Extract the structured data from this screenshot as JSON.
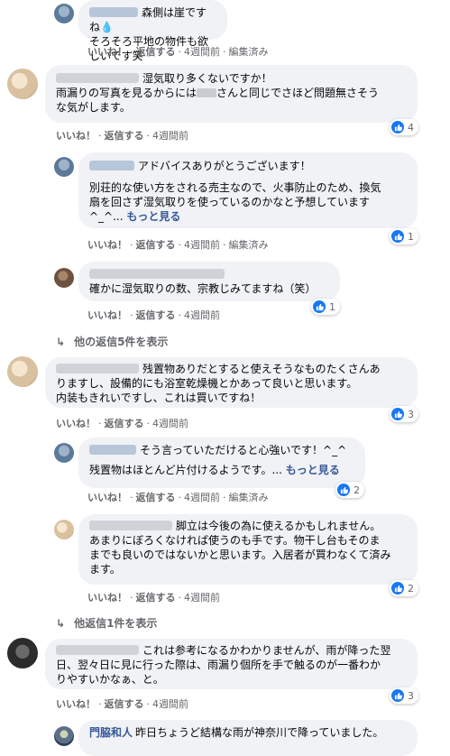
{
  "labels": {
    "like": "いいね！",
    "reply": "返信する",
    "edited": "編集済み",
    "dot": "·"
  },
  "comments": [
    {
      "text_lines": [
        "森側は崖ですね",
        "そろそろ平地の物件も欲しいです笑"
      ],
      "time": "4週間前",
      "edited": true
    },
    {
      "text_lines": [
        "湿気取り多くないですか！",
        "雨漏りの写真を見るからには",
        "さんと同じでさほど問題無さそう",
        "な気がします。"
      ],
      "time": "4週間前",
      "reactions": "4"
    },
    {
      "text_lines": [
        "アドバイスありがとうございます！",
        "別荘的な使い方をされる売主なので、火事防止のため、換気",
        "扇を回さず湿気取りを使っているのかなと予想しています",
        "^_^..."
      ],
      "see_more": "もっと見る",
      "time": "4週間前",
      "edited": true,
      "reactions": "1"
    },
    {
      "text_lines": [
        "確かに湿気取りの数、宗教じみてますね（笑）"
      ],
      "time": "4週間前",
      "reactions": "1"
    },
    {
      "more_replies": "他の返信5件を表示"
    },
    {
      "text_lines": [
        "残置物ありだとすると使えそうなものたくさんあ",
        "りますし、設備的にも浴室乾燥機とかあって良いと思います。",
        "内装もきれいですし、これは買いですね！"
      ],
      "time": "4週間前",
      "reactions": "3"
    },
    {
      "text_lines": [
        "そう言っていただけると心強いです！^_^",
        "残置物はほとんど片付けるようです。..."
      ],
      "see_more": "もっと見る",
      "time": "4週間前",
      "edited": true,
      "reactions": "2"
    },
    {
      "text_lines": [
        "脚立は今後の為に使えるかもしれません。",
        "あまりにぼろくなければ使うのも手です。物干し台もそのま",
        "までも良いのではないかと思います。入居者が買わなくて済み",
        "ます。"
      ],
      "time": "4週間前",
      "reactions": "2"
    },
    {
      "more_replies": "他返信1件を表示"
    },
    {
      "text_lines": [
        "これは参考になるかわかりませんが、雨が降った翌",
        "日、翌々日に見に行った際は、雨漏り個所を手で触るのが一番わか",
        "りやすいかなぁ、と。"
      ],
      "time": "4週間前",
      "reactions": "3"
    },
    {
      "author": "門脇和人",
      "text_lines": [
        "昨日ちょうど結構な雨が神奈川で降っていました。"
      ]
    }
  ],
  "colors": {
    "bubble": "#f0f2f5",
    "meta": "#65676b",
    "link": "#385898",
    "like_blue": "#1877f2"
  },
  "icons": {
    "like": "thumbs-up-icon",
    "reply_arrow": "reply-arrow-icon",
    "drop": "water-drop-emoji"
  }
}
